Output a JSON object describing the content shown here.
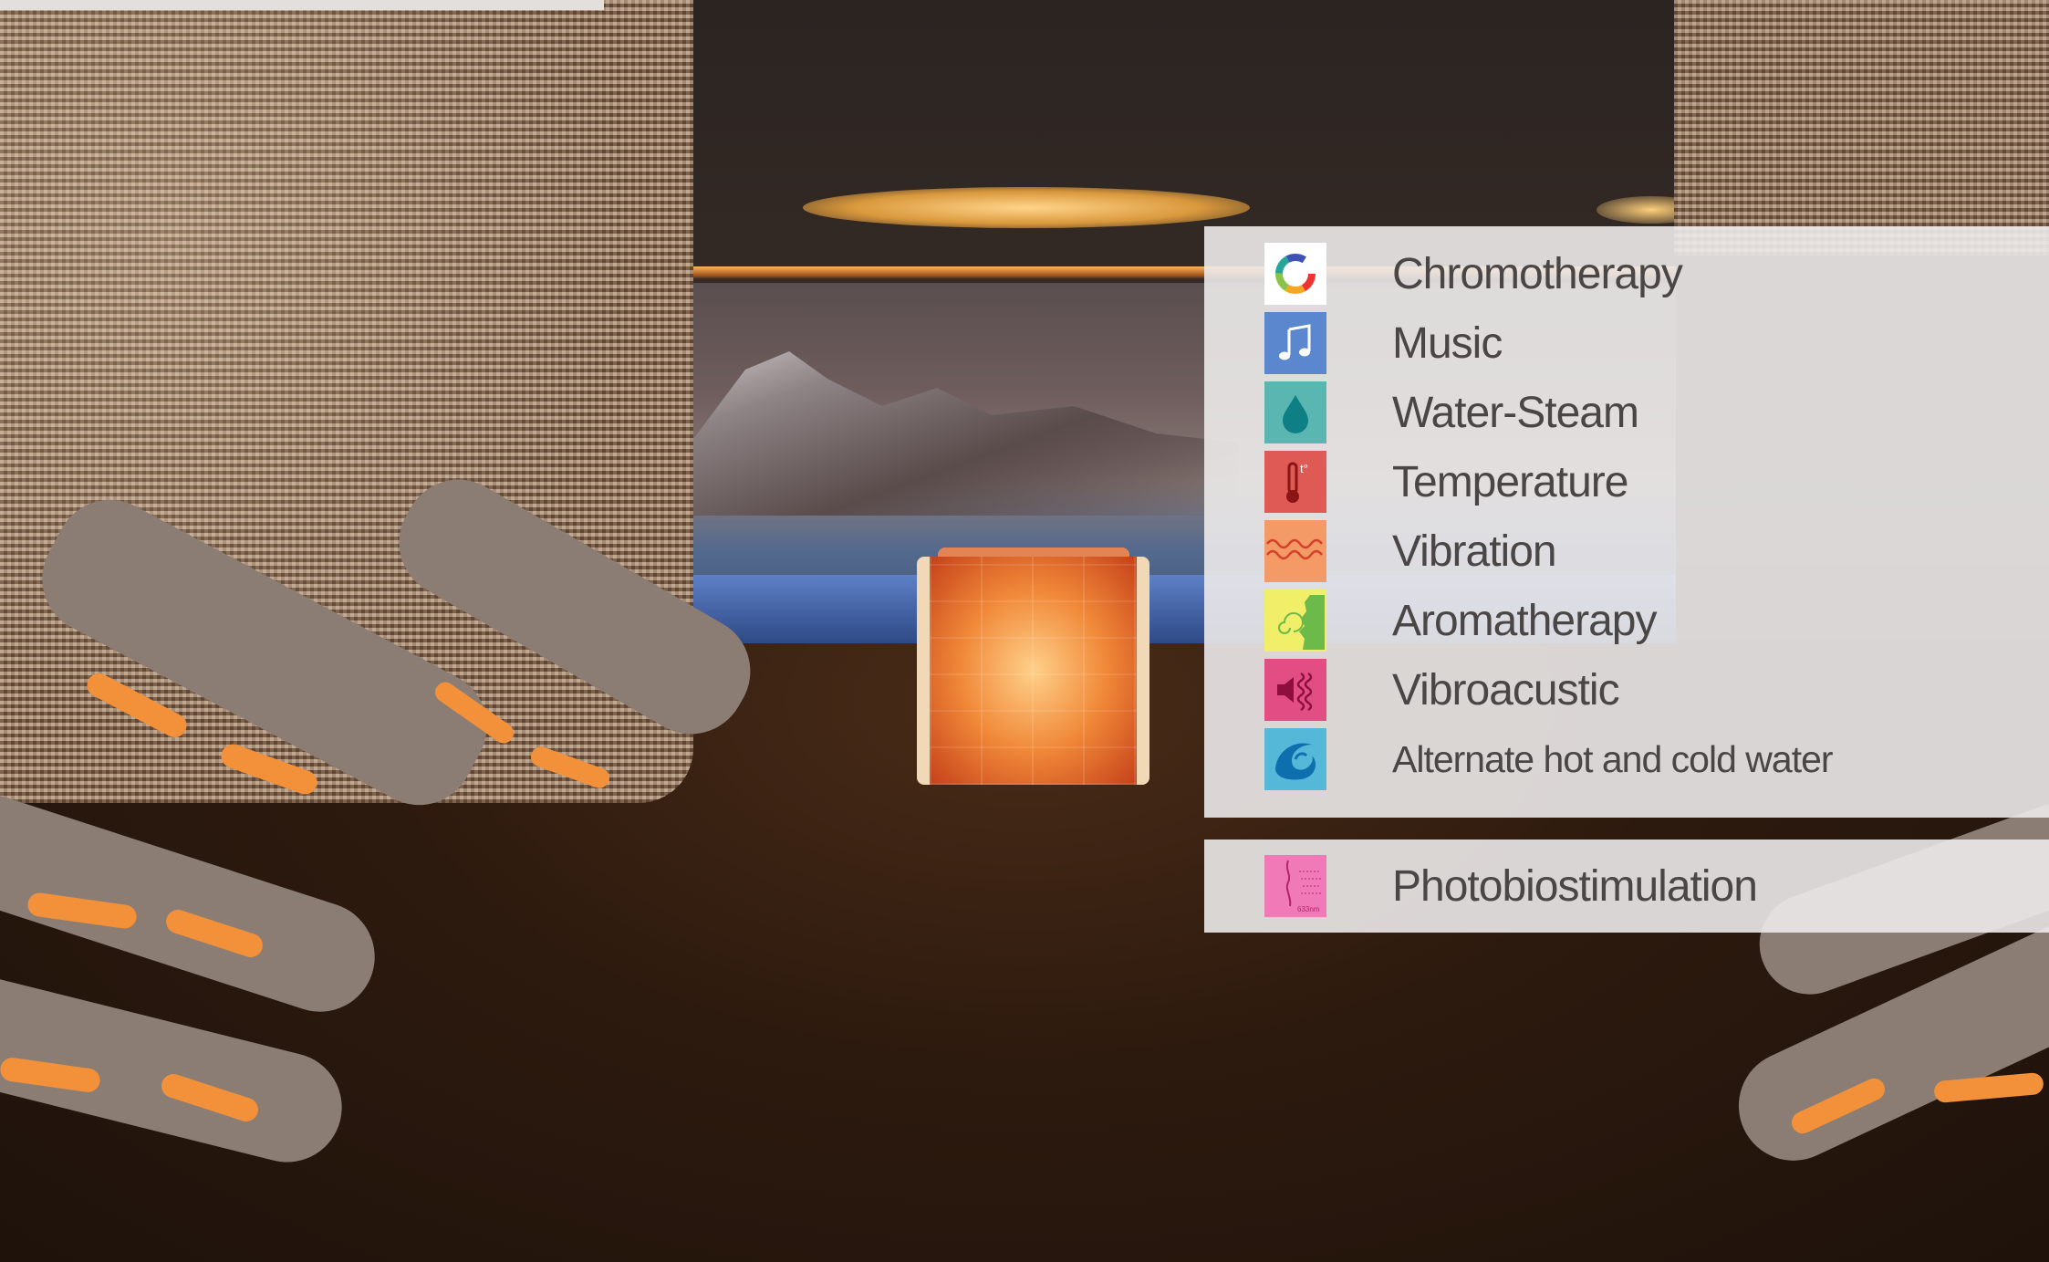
{
  "features": [
    {
      "label": "Chromotherapy",
      "icon": "color-ring-icon",
      "color": "#ffffff"
    },
    {
      "label": "Music",
      "icon": "music-note-icon",
      "color": "#5b87cf"
    },
    {
      "label": "Water-Steam",
      "icon": "water-drop-icon",
      "color": "#59b6b0"
    },
    {
      "label": "Temperature",
      "icon": "thermometer-icon",
      "color": "#df5a55"
    },
    {
      "label": "Vibration",
      "icon": "wave-icon",
      "color": "#f39a66"
    },
    {
      "label": "Aromatherapy",
      "icon": "face-scent-icon",
      "color": "#f1ee6a"
    },
    {
      "label": "Vibroacustic",
      "icon": "speaker-vibration-icon",
      "color": "#e24d84"
    },
    {
      "label": "Alternate hot and cold water",
      "icon": "water-wave-icon",
      "color": "#55b8d8"
    }
  ],
  "extra": {
    "label": "Photobiostimulation",
    "icon": "body-light-icon",
    "color": "#f07ab8",
    "wavelength": "633nm"
  }
}
